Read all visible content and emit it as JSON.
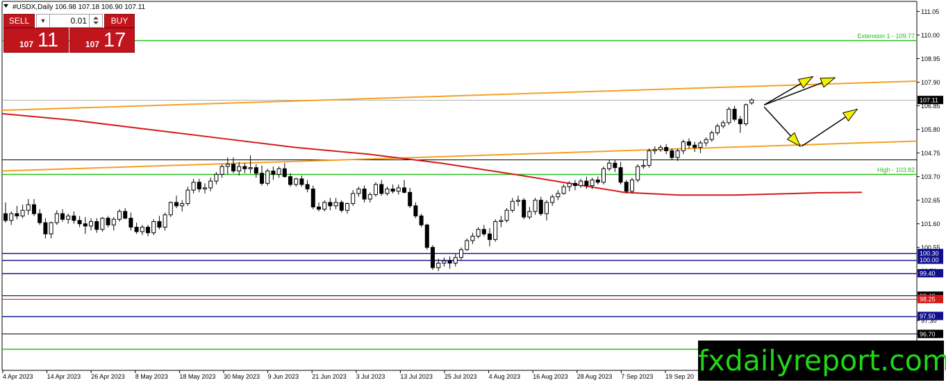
{
  "window": {
    "title": "#USDX,Daily",
    "ohlc": "106.98 107.18 106.90 107.11"
  },
  "trade_panel": {
    "sell_label": "SELL",
    "buy_label": "BUY",
    "lot_value": "0.01",
    "sell_price_small": "107",
    "sell_price_big": "11",
    "buy_price_small": "107",
    "buy_price_big": "17"
  },
  "watermark": "fxdailyreport.com",
  "colors": {
    "bull_candle": "#ffffff",
    "bear_candle": "#000000",
    "ma_line": "#d41a1a",
    "channel": "#f5a021",
    "green_level": "#22c21a",
    "blue_level": "#10108c",
    "forecast_arrow": "#f2f200",
    "logo_text": "#22d617"
  },
  "chart_data": {
    "type": "candlestick",
    "symbol": "#USDX",
    "timeframe": "Daily",
    "ylim": [
      96.7,
      111.6
    ],
    "y_ticks": [
      "111.05",
      "110.00",
      "108.95",
      "107.90",
      "106.85",
      "105.80",
      "104.75",
      "103.70",
      "102.65",
      "101.60",
      "100.55",
      "99.50",
      "98.40",
      "97.30",
      "96.70"
    ],
    "x_ticks": [
      "4 Apr 2023",
      "14 Apr 2023",
      "26 Apr 2023",
      "8 May 2023",
      "18 May 2023",
      "30 May 2023",
      "9 Jun 2023",
      "21 Jun 2023",
      "3 Jul 2023",
      "13 Jul 2023",
      "25 Jul 2023",
      "4 Aug 2023",
      "16 Aug 2023",
      "28 Aug 2023",
      "7 Sep 2023",
      "19 Sep 20"
    ],
    "current_price": "107.11",
    "level_labels": [
      {
        "text": "Extension 1 - 109.77",
        "value": 109.77
      },
      {
        "text": "High - 103.82",
        "value": 103.82
      }
    ],
    "price_tags": [
      {
        "text": "107.11",
        "value": 107.11,
        "style": "dark"
      },
      {
        "text": "100.30",
        "value": 100.3,
        "style": "blue"
      },
      {
        "text": "100.00",
        "value": 100.0,
        "style": "blue"
      },
      {
        "text": "99.40",
        "value": 99.4,
        "style": "blue"
      },
      {
        "text": "98.40",
        "value": 98.4,
        "style": "dark"
      },
      {
        "text": "98.25",
        "value": 98.25,
        "style": "red"
      },
      {
        "text": "97.50",
        "value": 97.5,
        "style": "blue"
      },
      {
        "text": "96.70",
        "value": 96.7,
        "style": "dark"
      }
    ],
    "horizontal_levels": [
      {
        "value": 109.77,
        "color": "green"
      },
      {
        "value": 104.45,
        "color": "black"
      },
      {
        "value": 103.82,
        "color": "green"
      },
      {
        "value": 100.3,
        "color": "blue"
      },
      {
        "value": 100.0,
        "color": "blue"
      },
      {
        "value": 99.4,
        "color": "blue"
      },
      {
        "value": 98.4,
        "color": "black"
      },
      {
        "value": 98.25,
        "color": "red"
      },
      {
        "value": 97.5,
        "color": "blue"
      },
      {
        "value": 96.7,
        "color": "black"
      },
      {
        "value": 96.05,
        "color": "green"
      }
    ],
    "channel_lines": [
      {
        "from": [
          0,
          106.65
        ],
        "to": [
          1.0,
          107.95
        ]
      },
      {
        "from": [
          0,
          103.95
        ],
        "to": [
          1.0,
          105.28
        ]
      }
    ],
    "moving_average": [
      [
        0.0,
        106.5
      ],
      [
        0.08,
        106.2
      ],
      [
        0.16,
        105.8
      ],
      [
        0.24,
        105.4
      ],
      [
        0.32,
        105.0
      ],
      [
        0.4,
        104.7
      ],
      [
        0.48,
        104.3
      ],
      [
        0.56,
        103.8
      ],
      [
        0.62,
        103.4
      ],
      [
        0.68,
        103.0
      ],
      [
        0.74,
        102.88
      ],
      [
        0.8,
        102.88
      ],
      [
        0.86,
        102.94
      ],
      [
        0.89,
        102.98
      ],
      [
        0.94,
        103.0
      ]
    ],
    "candles": [
      {
        "o": 102.05,
        "h": 102.55,
        "l": 101.65,
        "c": 101.75
      },
      {
        "o": 101.75,
        "h": 102.15,
        "l": 101.55,
        "c": 102.05
      },
      {
        "o": 102.05,
        "h": 102.4,
        "l": 101.8,
        "c": 101.95
      },
      {
        "o": 101.95,
        "h": 102.45,
        "l": 101.85,
        "c": 102.2
      },
      {
        "o": 102.2,
        "h": 102.7,
        "l": 102.0,
        "c": 102.45
      },
      {
        "o": 102.45,
        "h": 102.7,
        "l": 101.95,
        "c": 102.05
      },
      {
        "o": 102.05,
        "h": 102.25,
        "l": 101.55,
        "c": 101.65
      },
      {
        "o": 101.65,
        "h": 101.85,
        "l": 100.95,
        "c": 101.15
      },
      {
        "o": 101.15,
        "h": 101.7,
        "l": 100.95,
        "c": 101.65
      },
      {
        "o": 101.65,
        "h": 102.2,
        "l": 101.55,
        "c": 102.05
      },
      {
        "o": 102.05,
        "h": 102.25,
        "l": 101.7,
        "c": 101.8
      },
      {
        "o": 101.8,
        "h": 102.05,
        "l": 101.6,
        "c": 101.95
      },
      {
        "o": 101.95,
        "h": 102.15,
        "l": 101.6,
        "c": 101.75
      },
      {
        "o": 101.75,
        "h": 101.95,
        "l": 101.45,
        "c": 101.6
      },
      {
        "o": 101.6,
        "h": 101.9,
        "l": 101.15,
        "c": 101.5
      },
      {
        "o": 101.5,
        "h": 101.85,
        "l": 101.3,
        "c": 101.7
      },
      {
        "o": 101.7,
        "h": 101.85,
        "l": 101.2,
        "c": 101.35
      },
      {
        "o": 101.35,
        "h": 101.9,
        "l": 101.25,
        "c": 101.85
      },
      {
        "o": 101.85,
        "h": 101.95,
        "l": 101.45,
        "c": 101.55
      },
      {
        "o": 101.55,
        "h": 101.9,
        "l": 101.3,
        "c": 101.8
      },
      {
        "o": 101.8,
        "h": 102.25,
        "l": 101.7,
        "c": 102.15
      },
      {
        "o": 102.15,
        "h": 102.3,
        "l": 101.8,
        "c": 101.85
      },
      {
        "o": 101.85,
        "h": 102.1,
        "l": 101.3,
        "c": 101.45
      },
      {
        "o": 101.45,
        "h": 101.65,
        "l": 101.15,
        "c": 101.25
      },
      {
        "o": 101.25,
        "h": 101.55,
        "l": 101.1,
        "c": 101.45
      },
      {
        "o": 101.45,
        "h": 101.55,
        "l": 101.05,
        "c": 101.2
      },
      {
        "o": 101.2,
        "h": 101.8,
        "l": 101.1,
        "c": 101.7
      },
      {
        "o": 101.7,
        "h": 101.95,
        "l": 101.35,
        "c": 101.45
      },
      {
        "o": 101.45,
        "h": 102.1,
        "l": 101.3,
        "c": 102.0
      },
      {
        "o": 102.0,
        "h": 102.6,
        "l": 101.9,
        "c": 102.55
      },
      {
        "o": 102.55,
        "h": 102.85,
        "l": 102.3,
        "c": 102.4
      },
      {
        "o": 102.4,
        "h": 102.65,
        "l": 102.15,
        "c": 102.5
      },
      {
        "o": 102.5,
        "h": 103.25,
        "l": 102.4,
        "c": 103.1
      },
      {
        "o": 103.1,
        "h": 103.6,
        "l": 102.95,
        "c": 103.45
      },
      {
        "o": 103.45,
        "h": 103.6,
        "l": 103.0,
        "c": 103.15
      },
      {
        "o": 103.15,
        "h": 103.4,
        "l": 102.95,
        "c": 103.2
      },
      {
        "o": 103.2,
        "h": 103.65,
        "l": 103.05,
        "c": 103.5
      },
      {
        "o": 103.5,
        "h": 103.9,
        "l": 103.35,
        "c": 103.8
      },
      {
        "o": 103.8,
        "h": 104.25,
        "l": 103.65,
        "c": 104.15
      },
      {
        "o": 104.15,
        "h": 104.55,
        "l": 103.8,
        "c": 104.25
      },
      {
        "o": 104.25,
        "h": 104.55,
        "l": 103.85,
        "c": 103.95
      },
      {
        "o": 103.95,
        "h": 104.35,
        "l": 103.75,
        "c": 104.15
      },
      {
        "o": 104.15,
        "h": 104.3,
        "l": 103.85,
        "c": 104.05
      },
      {
        "o": 104.05,
        "h": 104.65,
        "l": 103.85,
        "c": 104.1
      },
      {
        "o": 104.1,
        "h": 104.25,
        "l": 103.65,
        "c": 103.85
      },
      {
        "o": 103.85,
        "h": 104.2,
        "l": 103.3,
        "c": 103.4
      },
      {
        "o": 103.4,
        "h": 104.05,
        "l": 103.3,
        "c": 103.95
      },
      {
        "o": 103.95,
        "h": 104.15,
        "l": 103.55,
        "c": 103.8
      },
      {
        "o": 103.8,
        "h": 104.15,
        "l": 103.65,
        "c": 104.05
      },
      {
        "o": 104.05,
        "h": 104.3,
        "l": 103.65,
        "c": 103.7
      },
      {
        "o": 103.7,
        "h": 103.85,
        "l": 103.25,
        "c": 103.35
      },
      {
        "o": 103.35,
        "h": 103.65,
        "l": 103.25,
        "c": 103.6
      },
      {
        "o": 103.6,
        "h": 103.75,
        "l": 103.25,
        "c": 103.35
      },
      {
        "o": 103.35,
        "h": 103.55,
        "l": 103.0,
        "c": 103.15
      },
      {
        "o": 103.15,
        "h": 103.3,
        "l": 102.25,
        "c": 102.35
      },
      {
        "o": 102.35,
        "h": 102.55,
        "l": 102.15,
        "c": 102.25
      },
      {
        "o": 102.25,
        "h": 102.65,
        "l": 102.15,
        "c": 102.55
      },
      {
        "o": 102.55,
        "h": 102.75,
        "l": 102.2,
        "c": 102.4
      },
      {
        "o": 102.4,
        "h": 102.75,
        "l": 102.25,
        "c": 102.55
      },
      {
        "o": 102.55,
        "h": 102.65,
        "l": 102.1,
        "c": 102.2
      },
      {
        "o": 102.2,
        "h": 102.55,
        "l": 102.05,
        "c": 102.5
      },
      {
        "o": 102.5,
        "h": 103.1,
        "l": 102.4,
        "c": 102.95
      },
      {
        "o": 102.95,
        "h": 103.25,
        "l": 102.8,
        "c": 103.15
      },
      {
        "o": 103.15,
        "h": 103.3,
        "l": 102.55,
        "c": 102.7
      },
      {
        "o": 102.7,
        "h": 103.0,
        "l": 102.55,
        "c": 102.9
      },
      {
        "o": 102.9,
        "h": 103.45,
        "l": 102.8,
        "c": 103.35
      },
      {
        "o": 103.35,
        "h": 103.55,
        "l": 102.85,
        "c": 102.95
      },
      {
        "o": 102.95,
        "h": 103.25,
        "l": 102.85,
        "c": 103.15
      },
      {
        "o": 103.15,
        "h": 103.35,
        "l": 102.95,
        "c": 103.05
      },
      {
        "o": 103.05,
        "h": 103.35,
        "l": 102.9,
        "c": 103.2
      },
      {
        "o": 103.2,
        "h": 103.55,
        "l": 102.95,
        "c": 103.0
      },
      {
        "o": 103.0,
        "h": 103.2,
        "l": 102.3,
        "c": 102.4
      },
      {
        "o": 102.4,
        "h": 102.55,
        "l": 101.85,
        "c": 101.95
      },
      {
        "o": 101.95,
        "h": 102.05,
        "l": 101.45,
        "c": 101.55
      },
      {
        "o": 101.55,
        "h": 101.6,
        "l": 100.45,
        "c": 100.55
      },
      {
        "o": 100.55,
        "h": 100.65,
        "l": 99.55,
        "c": 99.65
      },
      {
        "o": 99.65,
        "h": 100.05,
        "l": 99.5,
        "c": 99.85
      },
      {
        "o": 99.85,
        "h": 100.1,
        "l": 99.7,
        "c": 99.95
      },
      {
        "o": 99.95,
        "h": 100.15,
        "l": 99.6,
        "c": 99.85
      },
      {
        "o": 99.85,
        "h": 100.25,
        "l": 99.7,
        "c": 100.1
      },
      {
        "o": 100.1,
        "h": 100.55,
        "l": 100.0,
        "c": 100.45
      },
      {
        "o": 100.45,
        "h": 100.95,
        "l": 100.4,
        "c": 100.85
      },
      {
        "o": 100.85,
        "h": 101.2,
        "l": 100.7,
        "c": 101.05
      },
      {
        "o": 101.05,
        "h": 101.45,
        "l": 100.95,
        "c": 101.35
      },
      {
        "o": 101.35,
        "h": 101.55,
        "l": 101.05,
        "c": 101.15
      },
      {
        "o": 101.15,
        "h": 101.4,
        "l": 100.6,
        "c": 100.9
      },
      {
        "o": 100.9,
        "h": 101.8,
        "l": 100.8,
        "c": 101.7
      },
      {
        "o": 101.7,
        "h": 101.95,
        "l": 101.45,
        "c": 101.75
      },
      {
        "o": 101.75,
        "h": 102.3,
        "l": 101.65,
        "c": 102.2
      },
      {
        "o": 102.2,
        "h": 102.75,
        "l": 102.1,
        "c": 102.6
      },
      {
        "o": 102.6,
        "h": 102.85,
        "l": 102.4,
        "c": 102.65
      },
      {
        "o": 102.65,
        "h": 102.75,
        "l": 101.8,
        "c": 101.9
      },
      {
        "o": 101.9,
        "h": 102.35,
        "l": 101.8,
        "c": 102.15
      },
      {
        "o": 102.15,
        "h": 102.75,
        "l": 102.0,
        "c": 102.65
      },
      {
        "o": 102.65,
        "h": 102.8,
        "l": 101.95,
        "c": 102.05
      },
      {
        "o": 102.05,
        "h": 102.65,
        "l": 101.75,
        "c": 102.55
      },
      {
        "o": 102.55,
        "h": 102.9,
        "l": 102.4,
        "c": 102.8
      },
      {
        "o": 102.8,
        "h": 103.1,
        "l": 102.65,
        "c": 102.95
      },
      {
        "o": 102.95,
        "h": 103.35,
        "l": 102.9,
        "c": 103.25
      },
      {
        "o": 103.25,
        "h": 103.5,
        "l": 103.05,
        "c": 103.4
      },
      {
        "o": 103.4,
        "h": 103.55,
        "l": 103.1,
        "c": 103.3
      },
      {
        "o": 103.3,
        "h": 103.6,
        "l": 103.2,
        "c": 103.5
      },
      {
        "o": 103.5,
        "h": 103.7,
        "l": 103.15,
        "c": 103.3
      },
      {
        "o": 103.3,
        "h": 103.65,
        "l": 103.15,
        "c": 103.55
      },
      {
        "o": 103.55,
        "h": 103.7,
        "l": 103.35,
        "c": 103.45
      },
      {
        "o": 103.45,
        "h": 104.15,
        "l": 103.35,
        "c": 104.05
      },
      {
        "o": 104.05,
        "h": 104.45,
        "l": 103.95,
        "c": 104.3
      },
      {
        "o": 104.3,
        "h": 104.45,
        "l": 103.9,
        "c": 104.1
      },
      {
        "o": 104.1,
        "h": 104.35,
        "l": 103.35,
        "c": 103.45
      },
      {
        "o": 103.45,
        "h": 103.55,
        "l": 102.95,
        "c": 103.05
      },
      {
        "o": 103.05,
        "h": 103.65,
        "l": 102.95,
        "c": 103.55
      },
      {
        "o": 103.55,
        "h": 104.25,
        "l": 103.45,
        "c": 104.15
      },
      {
        "o": 104.15,
        "h": 104.45,
        "l": 104.05,
        "c": 104.2
      },
      {
        "o": 104.2,
        "h": 104.95,
        "l": 104.1,
        "c": 104.85
      },
      {
        "o": 104.85,
        "h": 105.05,
        "l": 104.7,
        "c": 104.9
      },
      {
        "o": 104.9,
        "h": 105.1,
        "l": 104.8,
        "c": 105.0
      },
      {
        "o": 105.0,
        "h": 105.15,
        "l": 104.7,
        "c": 104.85
      },
      {
        "o": 104.85,
        "h": 104.95,
        "l": 104.45,
        "c": 104.55
      },
      {
        "o": 104.55,
        "h": 104.95,
        "l": 104.4,
        "c": 104.85
      },
      {
        "o": 104.85,
        "h": 105.35,
        "l": 104.7,
        "c": 105.25
      },
      {
        "o": 105.25,
        "h": 105.4,
        "l": 104.95,
        "c": 105.1
      },
      {
        "o": 105.1,
        "h": 105.25,
        "l": 104.8,
        "c": 105.0
      },
      {
        "o": 105.0,
        "h": 105.3,
        "l": 104.75,
        "c": 105.2
      },
      {
        "o": 105.2,
        "h": 105.45,
        "l": 105.05,
        "c": 105.35
      },
      {
        "o": 105.35,
        "h": 105.75,
        "l": 105.25,
        "c": 105.65
      },
      {
        "o": 105.65,
        "h": 106.05,
        "l": 105.55,
        "c": 105.95
      },
      {
        "o": 105.95,
        "h": 106.2,
        "l": 105.85,
        "c": 106.1
      },
      {
        "o": 106.1,
        "h": 106.8,
        "l": 106.0,
        "c": 106.7
      },
      {
        "o": 106.7,
        "h": 106.85,
        "l": 106.15,
        "c": 106.25
      },
      {
        "o": 106.25,
        "h": 106.4,
        "l": 105.65,
        "c": 106.05
      },
      {
        "o": 106.05,
        "h": 106.95,
        "l": 105.95,
        "c": 106.9
      },
      {
        "o": 106.98,
        "h": 107.18,
        "l": 106.9,
        "c": 107.11
      }
    ],
    "forecast_arrows": [
      {
        "from": [
          106.89
        ],
        "to": [
          108.15
        ],
        "path": "upper-1"
      },
      {
        "from": [
          106.89
        ],
        "to": [
          108.1
        ],
        "path": "upper-2"
      },
      {
        "from": [
          106.8
        ],
        "to": [
          105.05
        ],
        "path": "drop"
      },
      {
        "from": [
          105.05
        ],
        "to": [
          106.7
        ],
        "path": "rebound"
      }
    ]
  }
}
